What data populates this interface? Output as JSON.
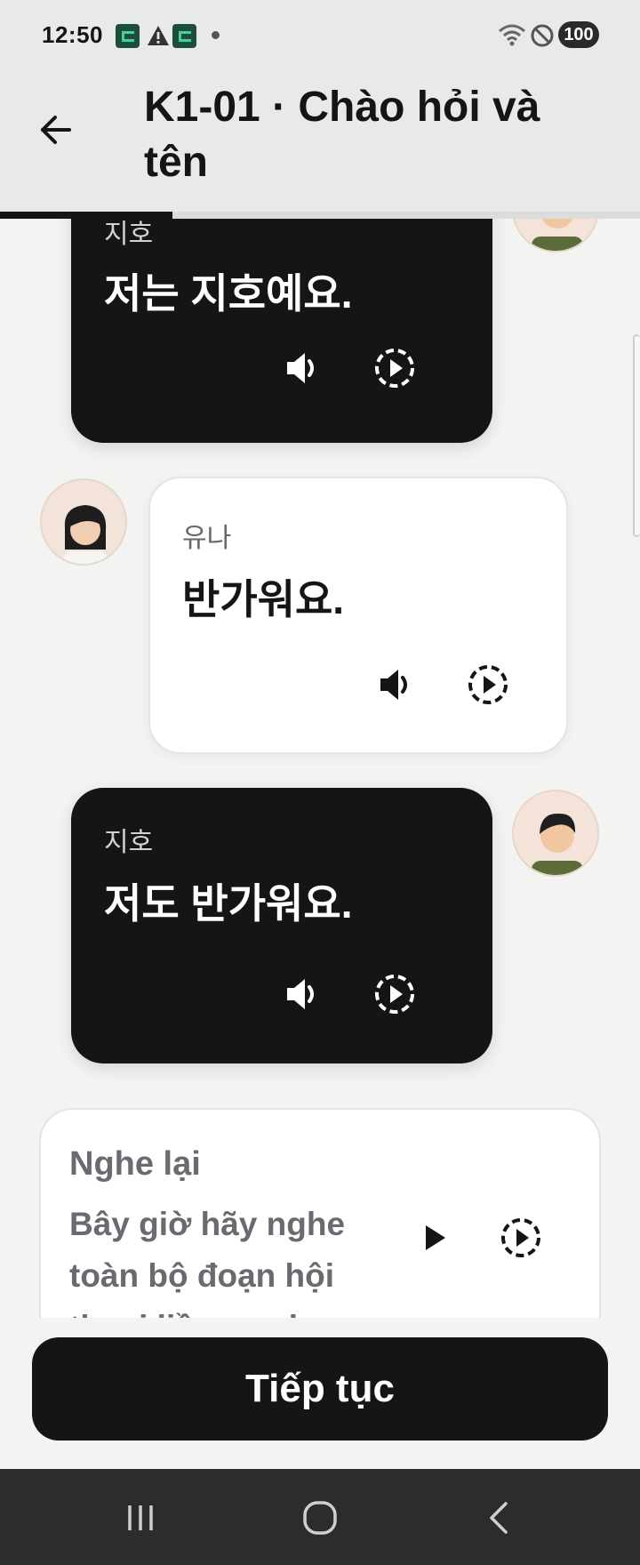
{
  "status_bar": {
    "time": "12:50",
    "battery": "100",
    "icons": [
      "app-notification-icon",
      "warning-icon",
      "app-notification-icon",
      "more-dot-icon",
      "wifi-icon",
      "do-not-disturb-icon",
      "battery-icon"
    ]
  },
  "app_bar": {
    "back_icon": "arrow-left-icon",
    "title": "K1-01 · Chào hỏi và tên",
    "progress": 0.27
  },
  "messages": [
    {
      "speaker": "지호",
      "text": "저는 지호예요.",
      "style": "dark",
      "avatar": "jiho-avatar"
    },
    {
      "speaker": "유나",
      "text": "반가워요.",
      "style": "light",
      "avatar": "yuna-avatar"
    },
    {
      "speaker": "지호",
      "text": "저도 반가워요.",
      "style": "dark",
      "avatar": "jiho-avatar"
    }
  ],
  "recap": {
    "title": "Nghe lại",
    "desc_line1": "Bây giờ hãy nghe",
    "desc_line2": "toàn bộ đoạn hội",
    "desc_line3": "thoại liền mạch."
  },
  "continue_label": "Tiếp tục",
  "nav_bar": [
    "recent-apps-icon",
    "home-icon",
    "back-icon"
  ],
  "colors": {
    "header_bg": "#e8e9ea",
    "page_bg": "#f3f3f1",
    "dark_bubble": "#151518",
    "light_bubble": "#ffffff",
    "muted_text": "#6a6b70",
    "nav_bg": "#2c2c2e"
  }
}
